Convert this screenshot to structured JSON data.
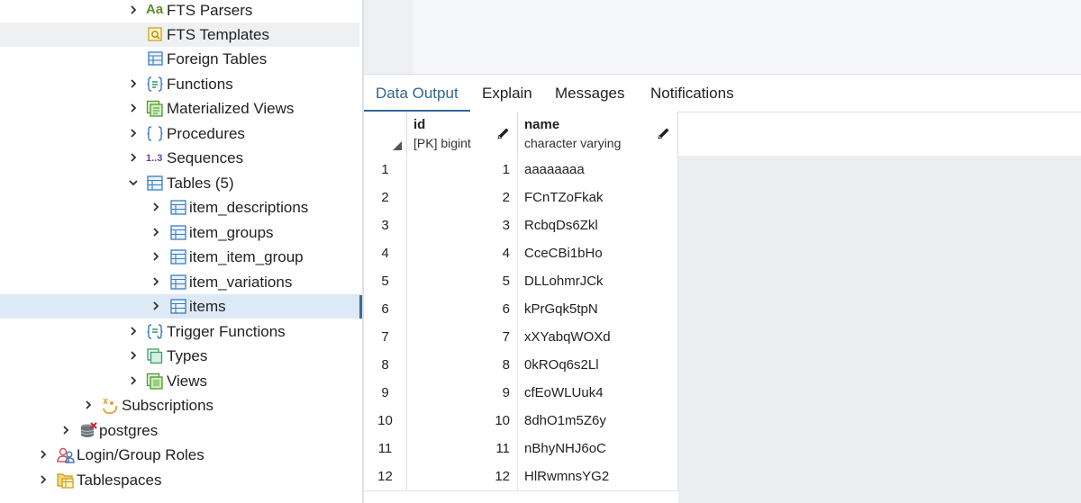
{
  "tree": {
    "items": [
      {
        "label": "FTS Parsers",
        "icon": "fts-parser-icon",
        "expandable": true
      },
      {
        "label": "FTS Templates",
        "icon": "fts-template-icon",
        "expandable": false
      },
      {
        "label": "Foreign Tables",
        "icon": "foreign-table-icon",
        "expandable": false
      },
      {
        "label": "Functions",
        "icon": "function-icon",
        "expandable": true
      },
      {
        "label": "Materialized Views",
        "icon": "materialized-view-icon",
        "expandable": true
      },
      {
        "label": "Procedures",
        "icon": "procedure-icon",
        "expandable": true
      },
      {
        "label": "Sequences",
        "icon": "sequence-icon",
        "expandable": true,
        "icon_text": "1..3"
      },
      {
        "label": "Tables (5)",
        "icon": "tables-icon",
        "expandable": true,
        "expanded": true
      },
      {
        "label": "item_descriptions",
        "icon": "table-icon",
        "expandable": true
      },
      {
        "label": "item_groups",
        "icon": "table-icon",
        "expandable": true
      },
      {
        "label": "item_item_group",
        "icon": "table-icon",
        "expandable": true
      },
      {
        "label": "item_variations",
        "icon": "table-icon",
        "expandable": true
      },
      {
        "label": "items",
        "icon": "table-icon",
        "expandable": true,
        "selected": true
      },
      {
        "label": "Trigger Functions",
        "icon": "trigger-function-icon",
        "expandable": true
      },
      {
        "label": "Types",
        "icon": "type-icon",
        "expandable": true
      },
      {
        "label": "Views",
        "icon": "view-icon",
        "expandable": true
      },
      {
        "label": "Subscriptions",
        "icon": "subscription-icon",
        "expandable": true
      },
      {
        "label": "postgres",
        "icon": "database-icon",
        "expandable": true
      },
      {
        "label": "Login/Group Roles",
        "icon": "roles-icon",
        "expandable": true
      },
      {
        "label": "Tablespaces",
        "icon": "tablespace-icon",
        "expandable": true
      }
    ],
    "fts_parsers_icon_text": "Aa"
  },
  "tabs": [
    {
      "label": "Data Output",
      "active": true
    },
    {
      "label": "Explain",
      "active": false
    },
    {
      "label": "Messages",
      "active": false
    },
    {
      "label": "Notifications",
      "active": false
    }
  ],
  "grid": {
    "columns": [
      {
        "name": "id",
        "type": "[PK] bigint"
      },
      {
        "name": "name",
        "type": "character varying"
      }
    ],
    "rows": [
      {
        "n": "1",
        "id": "1",
        "name": "aaaaaaaa"
      },
      {
        "n": "2",
        "id": "2",
        "name": "FCnTZoFkak"
      },
      {
        "n": "3",
        "id": "3",
        "name": "RcbqDs6Zkl"
      },
      {
        "n": "4",
        "id": "4",
        "name": "CceCBi1bHo"
      },
      {
        "n": "5",
        "id": "5",
        "name": "DLLohmrJCk"
      },
      {
        "n": "6",
        "id": "6",
        "name": "kPrGqk5tpN"
      },
      {
        "n": "7",
        "id": "7",
        "name": "xXYabqWOXd"
      },
      {
        "n": "8",
        "id": "8",
        "name": "0kROq6s2Ll"
      },
      {
        "n": "9",
        "id": "9",
        "name": "cfEoWLUuk4"
      },
      {
        "n": "10",
        "id": "10",
        "name": "8dhO1m5Z6y"
      },
      {
        "n": "11",
        "id": "11",
        "name": "nBhyNHJ6oC"
      },
      {
        "n": "12",
        "id": "12",
        "name": "HlRwmnsYG2"
      }
    ]
  },
  "colors": {
    "accent": "#326690",
    "selected_row": "#dde9f5",
    "hover_row": "#eef0f2",
    "grid_empty": "#ebeef1"
  }
}
